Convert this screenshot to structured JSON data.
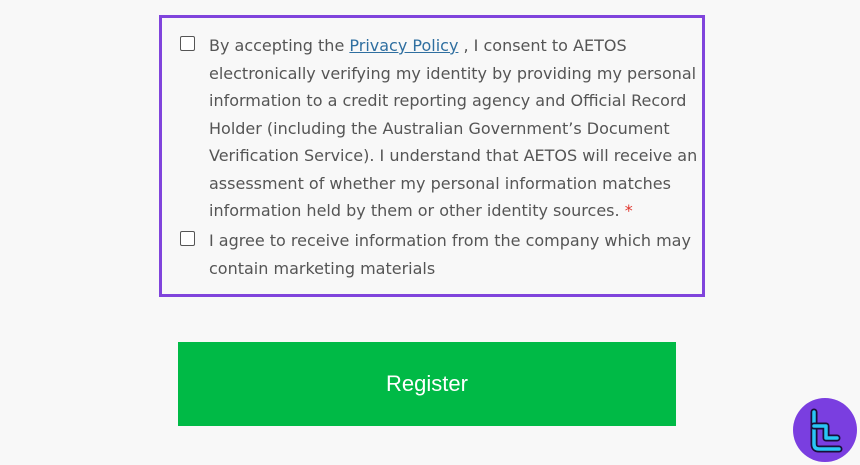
{
  "consent": {
    "privacy_prefix": "By accepting the ",
    "privacy_link": "Privacy Policy",
    "privacy_body": " , I consent to AETOS electronically verifying my identity by providing my personal information to a credit reporting agency and Official Record Holder (including the Australian Government’s Document Verification Service). I understand that AETOS will receive an assessment of whether my personal information matches information held by them or other identity sources.",
    "required_marker": "*",
    "marketing_text": "I agree to receive information from the company which may contain marketing materials"
  },
  "actions": {
    "register_label": "Register"
  },
  "colors": {
    "highlight_border": "#8044dc",
    "register_bg": "#00ba46",
    "logo_bg": "#7a3ee0",
    "logo_mark": "#29c6f5"
  },
  "icons": {
    "logo": "tradingfinder-logo-icon"
  }
}
